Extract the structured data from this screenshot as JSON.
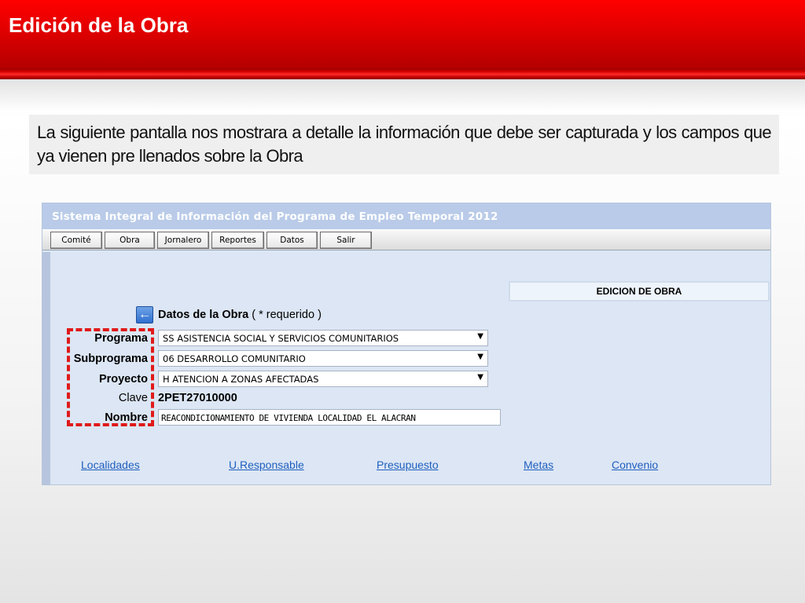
{
  "slide": {
    "title": "Edición de la Obra",
    "intro_text": "La siguiente pantalla nos mostrara a detalle la información que debe ser capturada y los campos que ya vienen pre llenados sobre la Obra"
  },
  "app": {
    "title": "Sistema Integral de Información del Programa de Empleo Temporal 2012",
    "menu": [
      "Comité",
      "Obra",
      "Jornalero",
      "Reportes",
      "Datos",
      "Salir"
    ],
    "panel_heading": "EDICION DE OBRA",
    "section": {
      "title": "Datos de la Obra",
      "required_note": "( * requerido )"
    },
    "fields": {
      "programa": {
        "label": "Programa",
        "value": "SS ASISTENCIA SOCIAL Y SERVICIOS COMUNITARIOS"
      },
      "subprograma": {
        "label": "Subprograma",
        "value": "06 DESARROLLO COMUNITARIO"
      },
      "proyecto": {
        "label": "Proyecto",
        "value": "H ATENCION A ZONAS AFECTADAS"
      },
      "clave": {
        "label": "Clave",
        "value": "2PET27010000"
      },
      "nombre": {
        "label": "Nombre",
        "value": "REACONDICIONAMIENTO DE VIVIENDA LOCALIDAD EL ALACRAN"
      }
    },
    "links": [
      "Localidades",
      "U.Responsable",
      "Presupuesto",
      "Metas",
      "Convenio"
    ]
  },
  "icons": {
    "back": "arrow-left-icon",
    "dropdown": "chevron-down-icon"
  },
  "colors": {
    "header_red": "#e00000",
    "app_bg": "#dce6f4",
    "highlight": "#e01a1a",
    "link": "#1f5fbf"
  }
}
